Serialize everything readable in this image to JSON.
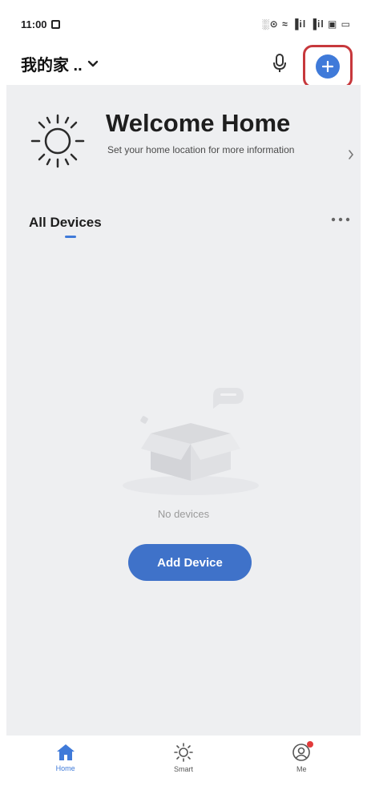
{
  "status_bar": {
    "time": "11:00",
    "icons_text": "░⊙ ≈ ▐il ▐il ▣ ▭"
  },
  "header": {
    "home_name": "我的家 ..",
    "icons": [
      "chevron-down-icon",
      "microphone-icon",
      "plus-icon"
    ]
  },
  "welcome": {
    "title": "Welcome Home",
    "subtitle": "Set your home location for more information",
    "icon": "sun-icon"
  },
  "devices": {
    "title": "All Devices",
    "empty_text": "No devices",
    "add_label": "Add Device"
  },
  "colors": {
    "accent": "#3f7ad9",
    "highlight_border": "#c7383c",
    "content_bg": "#eeeff1"
  },
  "nav": {
    "items": [
      {
        "label": "Home",
        "icon": "home-icon",
        "active": true
      },
      {
        "label": "Smart",
        "icon": "sun-icon",
        "active": false
      },
      {
        "label": "Me",
        "icon": "profile-icon",
        "active": false,
        "badge": true
      }
    ]
  }
}
